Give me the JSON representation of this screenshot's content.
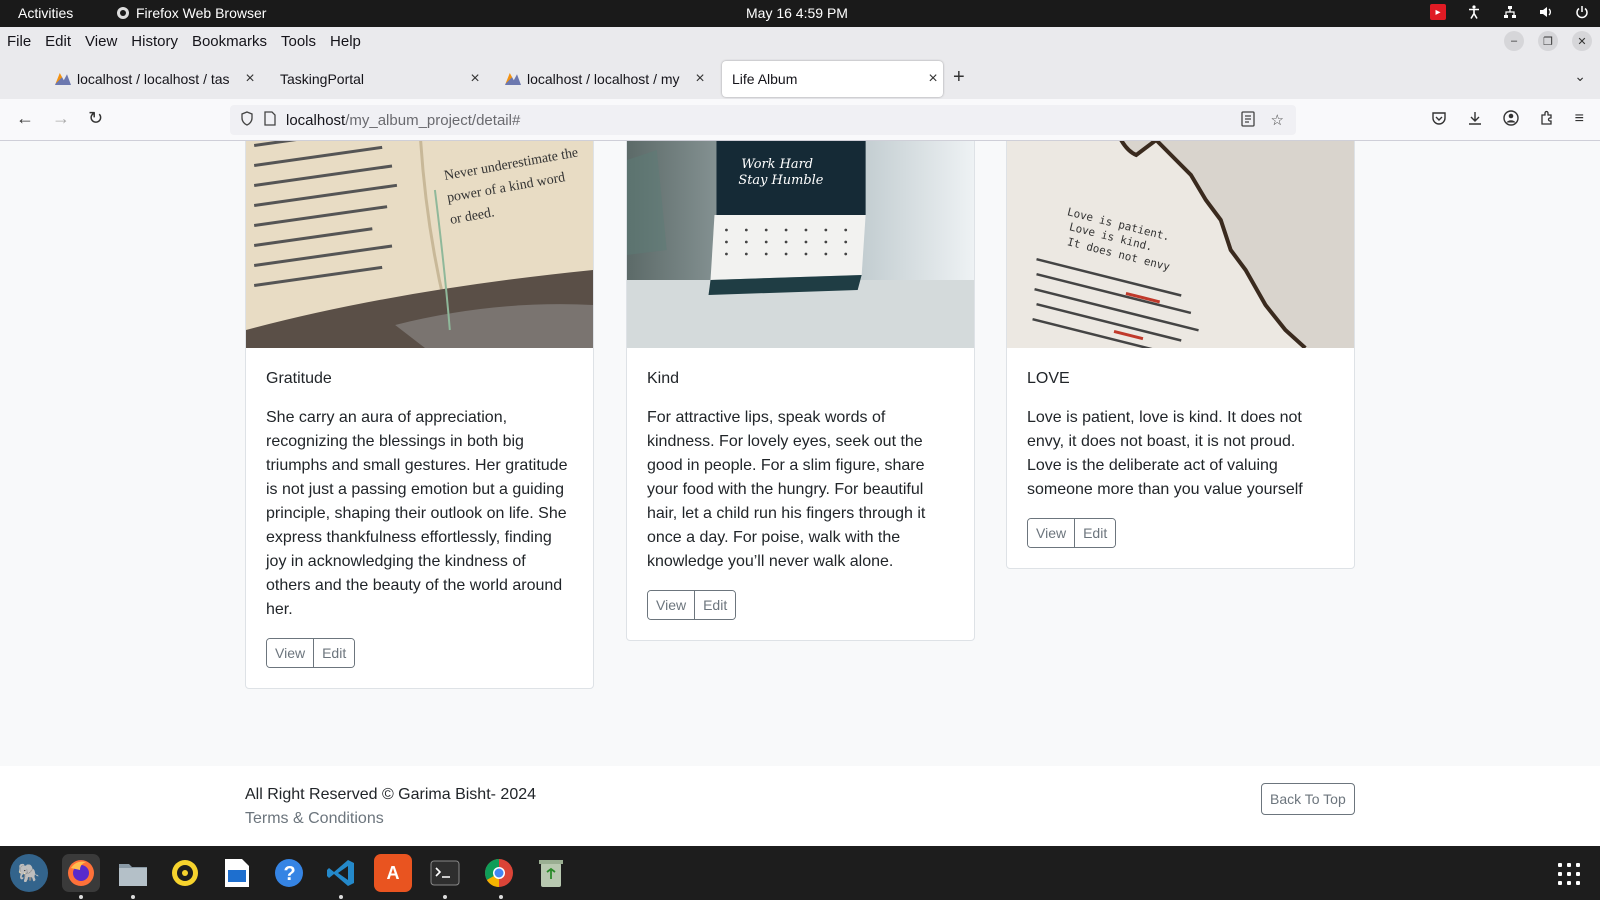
{
  "system_bar": {
    "activities": "Activities",
    "app_name": "Firefox Web Browser",
    "clock": "May 16  4:59 PM"
  },
  "menu": [
    "File",
    "Edit",
    "View",
    "History",
    "Bookmarks",
    "Tools",
    "Help"
  ],
  "tabs": [
    {
      "label": "localhost / localhost / tas"
    },
    {
      "label": "TaskingPortal"
    },
    {
      "label": "localhost / localhost / my"
    },
    {
      "label": "Life Album"
    }
  ],
  "url": {
    "host": "localhost",
    "path": "/my_album_project/detail#"
  },
  "cards": [
    {
      "title": "Gratitude",
      "text": "She carry an aura of appreciation, recognizing the blessings in both big triumphs and small gestures. Her gratitude is not just a passing emotion but a guiding principle, shaping their outlook on life. She express thankfulness effortlessly, finding joy in acknowledging the kindness of others and the beauty of the world around her.",
      "view": "View",
      "edit": "Edit",
      "image_text": [
        "Never underestimate the",
        "power of a kind word",
        "or deed."
      ]
    },
    {
      "title": "Kind",
      "text": "For attractive lips, speak words of kindness. For lovely eyes, seek out the good in people. For a slim figure, share your food with the hungry. For beautiful hair, let a child run his fingers through it once a day. For poise, walk with the knowledge you’ll never walk alone.",
      "view": "View",
      "edit": "Edit",
      "image_text": [
        "Work Hard",
        "Stay Humble"
      ]
    },
    {
      "title": "LOVE",
      "text": "Love is patient, love is kind. It does not envy, it does not boast, it is not proud. Love is the deliberate act of valuing someone more than you value yourself",
      "view": "View",
      "edit": "Edit",
      "image_text": [
        "Love is patient.",
        "Love is kind.",
        "It does not envy"
      ]
    }
  ],
  "footer": {
    "copyright": "All Right Reserved © Garima Bisht- 2024",
    "terms": "Terms & Conditions",
    "back_to_top": "Back To Top"
  }
}
